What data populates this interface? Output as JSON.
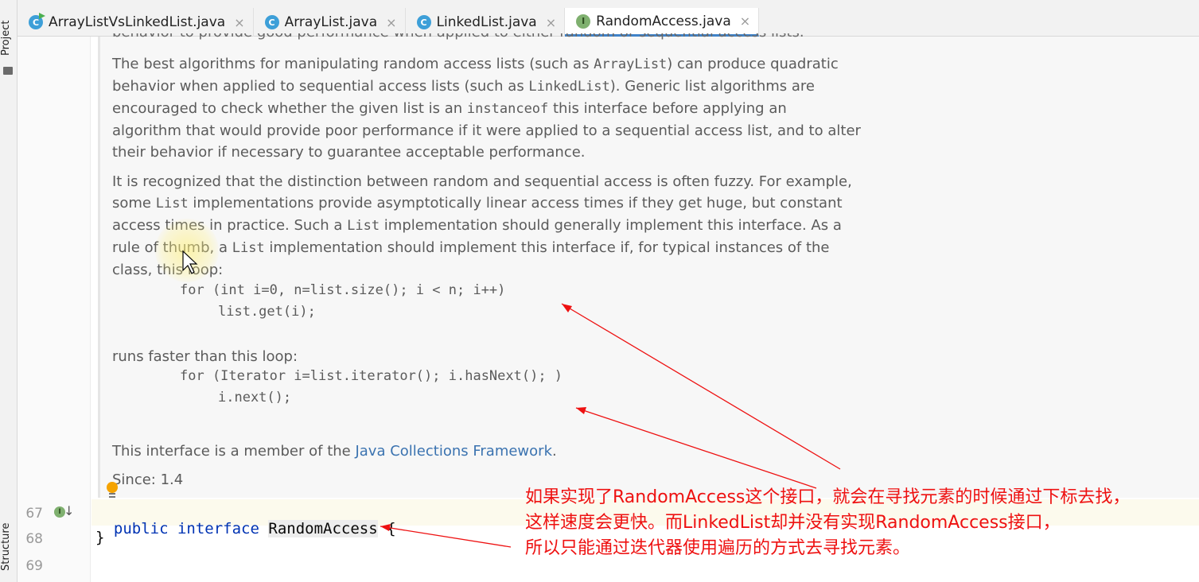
{
  "tabs": [
    {
      "label": "ArrayListVsLinkedList.java",
      "icon": "class-run-icon",
      "active": false
    },
    {
      "label": "ArrayList.java",
      "icon": "class-icon",
      "active": false
    },
    {
      "label": "LinkedList.java",
      "icon": "class-icon",
      "active": false
    },
    {
      "label": "RandomAccess.java",
      "icon": "interface-icon",
      "active": true
    }
  ],
  "tab_close_glyph": "×",
  "side_tools": {
    "project": "Project",
    "structure": "Structure"
  },
  "doc": {
    "cutoff_line": "behavior to provide good performance when applied to either random or sequential access lists.",
    "p1": [
      [
        "The best algorithms for manipulating random access lists (such as ",
        "ArrayList",
        ") can produce quadratic"
      ],
      [
        "behavior when applied to sequential access lists (such as ",
        "LinkedList",
        "). Generic list algorithms are"
      ],
      [
        "encouraged to check whether the given list is an ",
        "instanceof",
        " this interface before applying an"
      ],
      [
        "algorithm that would provide poor performance if it were applied to a sequential access list, and to alter",
        "",
        ""
      ],
      [
        "their behavior if necessary to guarantee acceptable performance.",
        "",
        ""
      ]
    ],
    "p2": [
      [
        "It is recognized that the distinction between random and sequential access is often fuzzy. For example,",
        "",
        ""
      ],
      [
        "some ",
        "List",
        " implementations provide asymptotically linear access times if they get huge, but constant"
      ],
      [
        "access times in practice. Such a ",
        "List",
        " implementation should generally implement this interface. As a"
      ],
      [
        "rule of thumb, a ",
        "List",
        " implementation should implement this interface if, for typical instances of the"
      ],
      [
        "class, this loop:",
        "",
        ""
      ]
    ],
    "loop1_line1": "for (int i=0, n=list.size(); i < n; i++)",
    "loop1_line2": "list.get(i);",
    "runs_faster": "runs faster than this loop:",
    "loop2_line1": "for (Iterator i=list.iterator(); i.hasNext(); )",
    "loop2_line2": "i.next();",
    "member_prefix": "This interface is a member of the ",
    "member_link": "Java Collections Framework",
    "member_suffix": ".",
    "since": "Since: 1.4"
  },
  "code": {
    "line_numbers": [
      "67",
      "68",
      "69"
    ],
    "line67_kw1": "public",
    "line67_kw2": "interface",
    "line67_name": "RandomAccess",
    "line67_brace": "{",
    "line68": "}"
  },
  "annotation": [
    "如果实现了RandomAccess这个接口，就会在寻找元素的时候通过下标去找，",
    "这样速度会更快。而LinkedList却并没有实现RandomAccess接口，",
    "所以只能通过迭代器使用遍历的方式去寻找元素。"
  ],
  "colors": {
    "annotation": "#ee1111",
    "keyword": "#0033b3",
    "link": "#3b73b0",
    "doc_text": "#5b5b5b"
  }
}
